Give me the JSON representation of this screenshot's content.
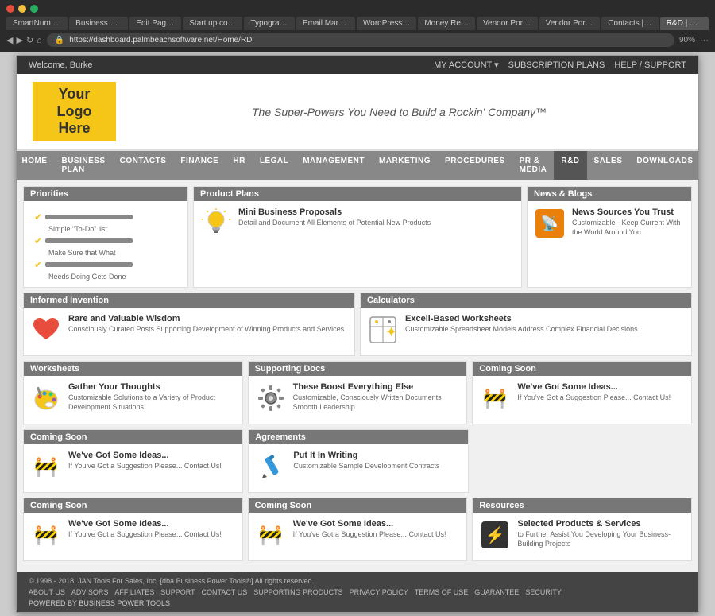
{
  "browser": {
    "tabs": [
      {
        "label": "SmartNumbe...",
        "active": false
      },
      {
        "label": "Business Po...",
        "active": false
      },
      {
        "label": "Edit Page ◀",
        "active": false
      },
      {
        "label": "Start up com...",
        "active": false
      },
      {
        "label": "Typography",
        "active": false
      },
      {
        "label": "Email Marke...",
        "active": false
      },
      {
        "label": "WordPress T...",
        "active": false
      },
      {
        "label": "Money Revi...",
        "active": false
      },
      {
        "label": "Vendor Portu...",
        "active": false
      },
      {
        "label": "Vendor Portu...",
        "active": false
      },
      {
        "label": "Contacts | F...",
        "active": false
      },
      {
        "label": "R&D | Bu...",
        "active": true
      }
    ],
    "url": "https://dashboard.palmbeachsoftware.net/Home/RD",
    "zoom": "90%"
  },
  "topnav": {
    "welcome": "Welcome, Burke",
    "account": "MY ACCOUNT ▾",
    "subscription": "SUBSCRIPTION PLANS",
    "help": "HELP / SUPPORT"
  },
  "header": {
    "logo": "Your\nLogo\nHere",
    "tagline": "The Super-Powers You Need to Build a Rockin' Company™"
  },
  "mainnav": {
    "items": [
      {
        "label": "HOME",
        "active": false
      },
      {
        "label": "BUSINESS PLAN",
        "active": false
      },
      {
        "label": "CONTACTS",
        "active": false
      },
      {
        "label": "FINANCE",
        "active": false
      },
      {
        "label": "HR",
        "active": false
      },
      {
        "label": "LEGAL",
        "active": false
      },
      {
        "label": "MANAGEMENT",
        "active": false
      },
      {
        "label": "MARKETING",
        "active": false
      },
      {
        "label": "PROCEDURES",
        "active": false
      },
      {
        "label": "PR & MEDIA",
        "active": false
      },
      {
        "label": "R&D",
        "active": true
      },
      {
        "label": "SALES",
        "active": false
      },
      {
        "label": "DOWNLOADS",
        "active": false
      }
    ]
  },
  "sections": {
    "priorities": {
      "header": "Priorities",
      "lines": [
        "Simple 'To-Do' List",
        "Make Sure that What",
        "Needs Doing Gets Done"
      ]
    },
    "product_plans": {
      "header": "Product Plans",
      "title": "Mini Business Proposals",
      "desc": "Detail and Document All Elements of Potential New Products"
    },
    "news_blogs": {
      "header": "News & Blogs",
      "title": "News Sources You Trust",
      "desc": "Customizable - Keep Current With the World Around You"
    },
    "informed_invention": {
      "header": "Informed Invention",
      "title": "Rare and Valuable Wisdom",
      "desc": "Consciously Curated Posts Supporting Development of Winning Products and Services"
    },
    "calculators": {
      "header": "Calculators",
      "title": "Excell-Based Worksheets",
      "desc": "Customizable Spreadsheet Models Address Complex Financial Decisions"
    },
    "worksheets": {
      "header": "Worksheets",
      "title": "Gather Your Thoughts",
      "desc": "Customizable Solutions to a Variety of Product Development Situations"
    },
    "supporting_docs": {
      "header": "Supporting Docs",
      "title": "These Boost Everything Else",
      "desc": "Customizable, Consciously Written Documents Smooth Leadership"
    },
    "coming_soon_1": {
      "header": "Coming Soon",
      "title": "We've Got Some Ideas...",
      "desc": "If You've Got a Suggestion Please... Contact Us!"
    },
    "coming_soon_2": {
      "header": "Coming Soon",
      "title": "We've Got Some Ideas...",
      "desc": "If You've Got a Suggestion Please... Contact Us!"
    },
    "agreements": {
      "header": "Agreements",
      "title": "Put It In Writing",
      "desc": "Customizable Sample Development Contracts"
    },
    "coming_soon_3": {
      "header": "Coming Soon",
      "title": "We've Got Some Ideas...",
      "desc": "If You've Got a Suggestion Please... Contact Us!"
    },
    "coming_soon_4": {
      "header": "Coming Soon",
      "title": "We've Got Some Ideas...",
      "desc": "If You've Got a Suggestion Please... Contact Us!"
    },
    "resources": {
      "header": "Resources",
      "title": "Selected Products & Services",
      "desc": "to Further Assist You Developing Your Business-Building Projects"
    }
  },
  "footer": {
    "copyright": "© 1998 - 2018. JAN Tools For Sales, Inc. [dba Business Power Tools®] All rights reserved.",
    "links": [
      "ABOUT US",
      "ADVISORS",
      "AFFILIATES",
      "SUPPORT",
      "CONTACT US",
      "SUPPORTING PRODUCTS",
      "PRIVACY POLICY",
      "TERMS OF USE",
      "GUARANTEE",
      "SECURITY"
    ],
    "powered": "POWERED BY BUSINESS POWER TOOLS"
  }
}
